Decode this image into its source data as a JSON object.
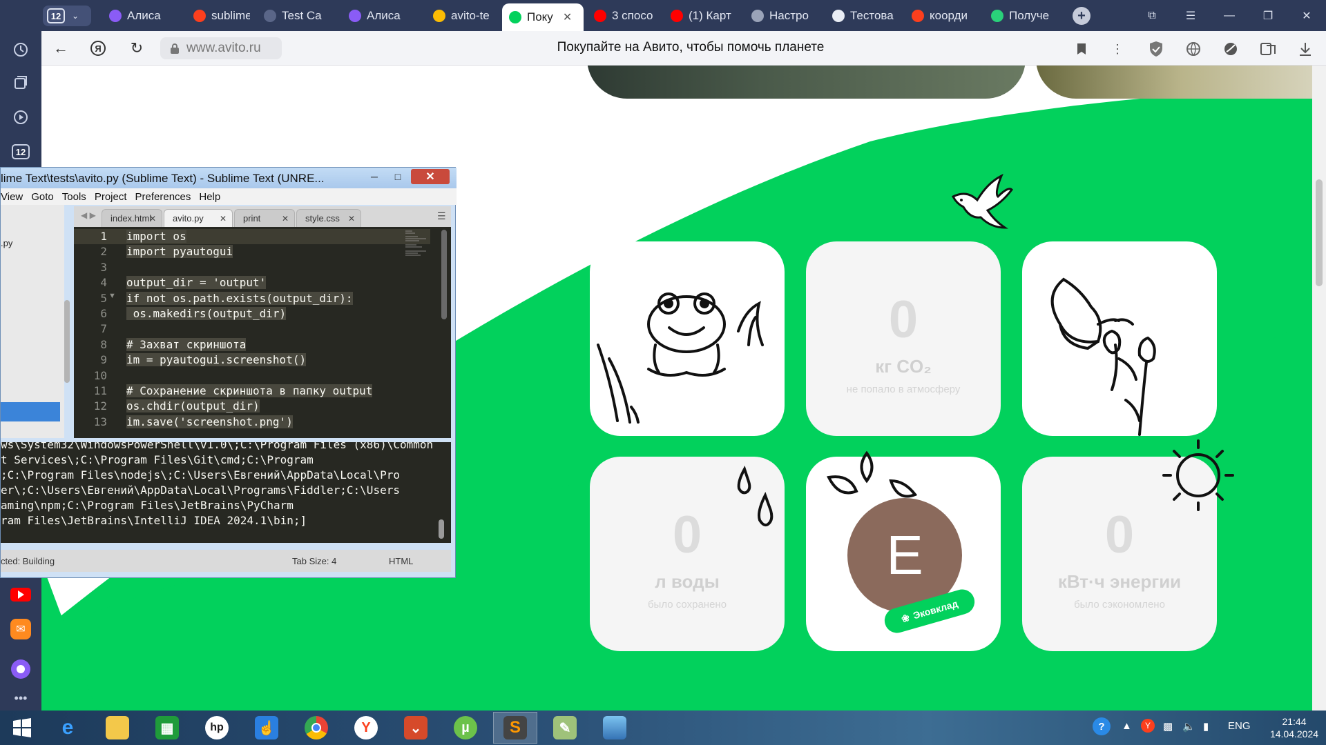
{
  "browser": {
    "tab_count": "12",
    "tabs": [
      {
        "label": "Алиса",
        "color": "#8a5cf6"
      },
      {
        "label": "sublime",
        "color": "#fc3f1d"
      },
      {
        "label": "Test Ca",
        "color": "#5a6688"
      },
      {
        "label": "Алиса",
        "color": "#8a5cf6"
      },
      {
        "label": "avito-te",
        "color": "#fbbc04"
      },
      {
        "label": "Поку",
        "color": "#02d15c",
        "active": true
      },
      {
        "label": "3 спосо",
        "color": "#ff0000"
      },
      {
        "label": "(1) Карт",
        "color": "#ff0000"
      },
      {
        "label": "Настро",
        "color": "#9aa3b8"
      },
      {
        "label": "Тестова",
        "color": "#e9edf5"
      },
      {
        "label": "коорди",
        "color": "#fc3f1d"
      },
      {
        "label": "Получе",
        "color": "#2ad17a"
      }
    ],
    "address": "www.avito.ru",
    "page_title": "Покупайте на Авито, чтобы помочь планете"
  },
  "eco_page": {
    "accent_color": "#02d15c",
    "cards": [
      {
        "value": "0",
        "unit": "кг CO₂",
        "caption": "не попало в атмосферу"
      },
      {
        "value": "0",
        "unit": "л воды",
        "caption": "было сохранено"
      },
      {
        "value": "0",
        "unit": "кВт·ч энергии",
        "caption": "было сэкономлено"
      }
    ],
    "avatar_letter": "Е",
    "badge_label": "Эковклад"
  },
  "sublime": {
    "title": "lime Text\\tests\\avito.py (Sublime Text) - Sublime Text (UNRE...",
    "menu": [
      "View",
      "Goto",
      "Tools",
      "Project",
      "Preferences",
      "Help"
    ],
    "sidebar_file": ".py",
    "tabs": [
      {
        "label": "index.html"
      },
      {
        "label": "avito.py",
        "active": true
      },
      {
        "label": "print"
      },
      {
        "label": "style.css"
      }
    ],
    "code": [
      {
        "n": "1",
        "text": "import os"
      },
      {
        "n": "2",
        "text": "import pyautogui"
      },
      {
        "n": "3",
        "text": ""
      },
      {
        "n": "4",
        "text": "output_dir = 'output'"
      },
      {
        "n": "5",
        "text": "if not os.path.exists(output_dir):"
      },
      {
        "n": "6",
        "text": " os.makedirs(output_dir)"
      },
      {
        "n": "7",
        "text": ""
      },
      {
        "n": "8",
        "text": "# Захват скриншота"
      },
      {
        "n": "9",
        "text": "im = pyautogui.screenshot()"
      },
      {
        "n": "10",
        "text": ""
      },
      {
        "n": "11",
        "text": "# Сохранение скриншота в папку output"
      },
      {
        "n": "12",
        "text": "os.chdir(output_dir)"
      },
      {
        "n": "13",
        "text": "im.save('screenshot.png')"
      }
    ],
    "console": [
      "ws\\System32\\WindowsPowerShell\\v1.0\\;C:\\Program Files (x86)\\Common",
      "t Services\\;C:\\Program Files\\Git\\cmd;C:\\Program",
      ";C:\\Program Files\\nodejs\\;C:\\Users\\Евгений\\AppData\\Local\\Pro",
      "er\\;C:\\Users\\Евгений\\AppData\\Local\\Programs\\Fiddler;C:\\Users",
      "aming\\npm;C:\\Program Files\\JetBrains\\PyCharm",
      "ram Files\\JetBrains\\IntelliJ IDEA 2024.1\\bin;]"
    ],
    "status_left": "cted: Building",
    "status_tab": "Tab Size: 4",
    "status_syntax": "HTML"
  },
  "taskbar": {
    "lang": "ENG",
    "time": "21:44",
    "date": "14.04.2024"
  }
}
